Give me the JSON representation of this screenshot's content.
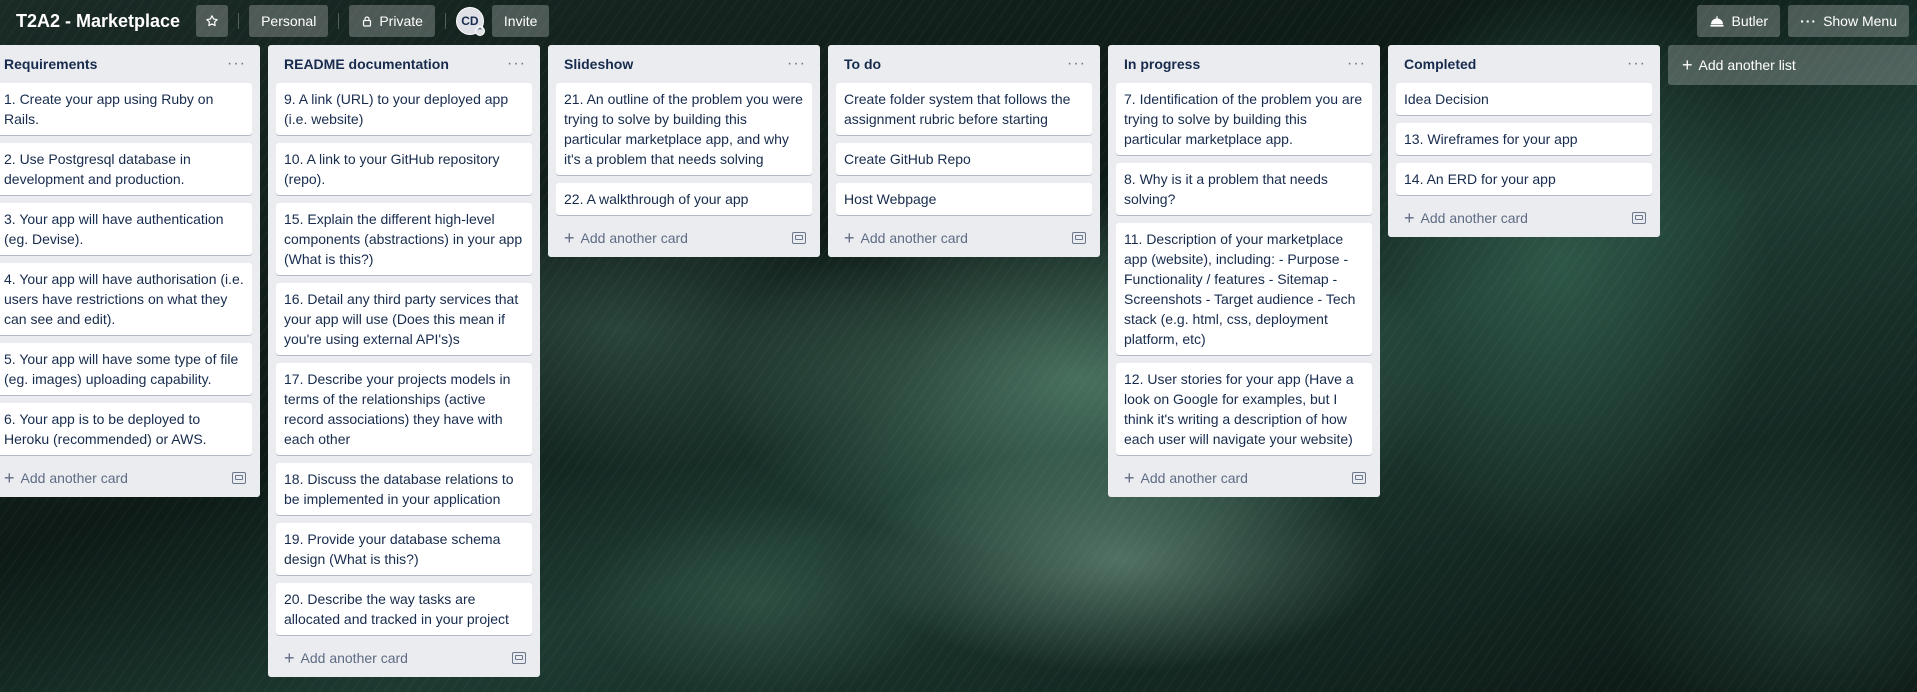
{
  "header": {
    "board_title": "T2A2 - Marketplace",
    "team_label": "Personal",
    "visibility_label": "Private",
    "avatar_initials": "CD",
    "invite_label": "Invite",
    "butler_label": "Butler",
    "show_menu_label": "Show Menu"
  },
  "add_card_label": "Add another card",
  "add_list_label": "Add another list",
  "lists": [
    {
      "title": "Requirements",
      "cards": [
        "1. Create your app using Ruby on Rails.",
        "2. Use Postgresql database in development and production.",
        "3. Your app will have authentication (eg. Devise).",
        "4. Your app will have authorisation (i.e. users have restrictions on what they can see and edit).",
        "5. Your app will have some type of file (eg. images) uploading capability.",
        "6. Your app is to be deployed to Heroku (recommended) or AWS."
      ]
    },
    {
      "title": "README documentation",
      "cards": [
        "9. A link (URL) to your deployed app (i.e. website)",
        "10. A link to your GitHub repository (repo).",
        "15. Explain the different high-level components (abstractions) in your app (What is this?)",
        "16. Detail any third party services that your app will use (Does this mean if you're using external API's)s",
        "17. Describe your projects models in terms of the relationships (active record associations) they have with each other",
        "18. Discuss the database relations to be implemented in your application",
        "19. Provide your database schema design (What is this?)",
        "20. Describe the way tasks are allocated and tracked in your project"
      ]
    },
    {
      "title": "Slideshow",
      "cards": [
        "21. An outline of the problem you were trying to solve by building this particular marketplace app, and why it's a problem that needs solving",
        "22. A walkthrough of your app"
      ]
    },
    {
      "title": "To do",
      "cards": [
        "Create folder system that follows the assignment rubric before starting",
        "Create GitHub Repo",
        "Host Webpage"
      ]
    },
    {
      "title": "In progress",
      "cards": [
        "7. Identification of the problem you are trying to solve by building this particular marketplace app.",
        "8. Why is it a problem that needs solving?",
        "11. Description of your marketplace app (website), including: - Purpose - Functionality / features - Sitemap - Screenshots - Target audience - Tech stack (e.g. html, css, deployment platform, etc)",
        "12. User stories for your app (Have a look on Google for examples, but I think it's writing a description of how each user will navigate your website)"
      ]
    },
    {
      "title": "Completed",
      "cards": [
        "Idea Decision",
        "13. Wireframes for your app",
        "14. An ERD for your app"
      ]
    }
  ]
}
